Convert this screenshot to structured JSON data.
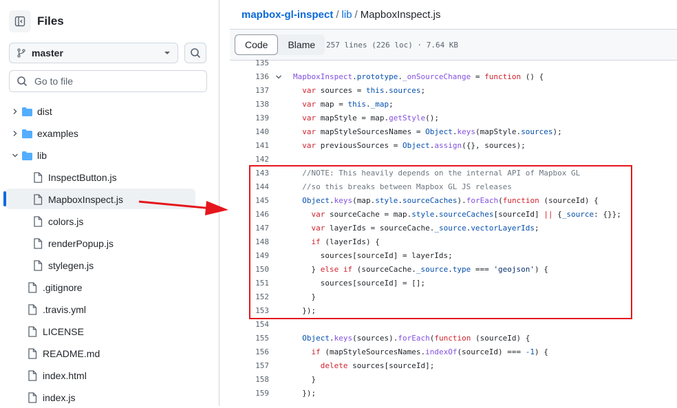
{
  "sidebar": {
    "title": "Files",
    "branch": "master",
    "goto_placeholder": "Go to file",
    "tree": [
      {
        "name": "dist",
        "type": "folder",
        "expanded": false
      },
      {
        "name": "examples",
        "type": "folder",
        "expanded": false
      },
      {
        "name": "lib",
        "type": "folder",
        "expanded": true
      },
      {
        "name": "InspectButton.js",
        "type": "file"
      },
      {
        "name": "MapboxInspect.js",
        "type": "file",
        "selected": true
      },
      {
        "name": "colors.js",
        "type": "file"
      },
      {
        "name": "renderPopup.js",
        "type": "file"
      },
      {
        "name": "stylegen.js",
        "type": "file"
      },
      {
        "name": ".gitignore",
        "type": "file"
      },
      {
        "name": ".travis.yml",
        "type": "file"
      },
      {
        "name": "LICENSE",
        "type": "file"
      },
      {
        "name": "README.md",
        "type": "file"
      },
      {
        "name": "index.html",
        "type": "file"
      },
      {
        "name": "index.js",
        "type": "file"
      }
    ]
  },
  "breadcrumb": {
    "repo": "mapbox-gl-inspect",
    "sep1": "/",
    "dir": "lib",
    "sep2": "/",
    "file": "MapboxInspect.js"
  },
  "toolbar": {
    "code_tab": "Code",
    "blame_tab": "Blame",
    "info": "257 lines (226 loc) · 7.64 KB"
  },
  "code_lines": [
    {
      "n": "135",
      "html": ""
    },
    {
      "n": "136",
      "html": "<span class='f'>MapboxInspect</span>.<span class='v'>prototype</span>.<span class='f'>_onSourceChange</span> = <span class='k'>function</span> () {"
    },
    {
      "n": "137",
      "html": "  <span class='k'>var</span> sources = <span class='v'>this</span>.<span class='v'>sources</span>;"
    },
    {
      "n": "138",
      "html": "  <span class='k'>var</span> map = <span class='v'>this</span>.<span class='v'>_map</span>;"
    },
    {
      "n": "139",
      "html": "  <span class='k'>var</span> mapStyle = map.<span class='f'>getStyle</span>();"
    },
    {
      "n": "140",
      "html": "  <span class='k'>var</span> mapStyleSourcesNames = <span class='v'>Object</span>.<span class='f'>keys</span>(mapStyle.<span class='v'>sources</span>);"
    },
    {
      "n": "141",
      "html": "  <span class='k'>var</span> previousSources = <span class='v'>Object</span>.<span class='f'>assign</span>({}, sources);"
    },
    {
      "n": "142",
      "html": ""
    },
    {
      "n": "143",
      "html": "  <span class='c'>//NOTE: This heavily depends on the internal API of Mapbox GL</span>"
    },
    {
      "n": "144",
      "html": "  <span class='c'>//so this breaks between Mapbox GL JS releases</span>"
    },
    {
      "n": "145",
      "html": "  <span class='v'>Object</span>.<span class='f'>keys</span>(map.<span class='v'>style</span>.<span class='v'>sourceCaches</span>).<span class='f'>forEach</span>(<span class='k'>function</span> (sourceId) {"
    },
    {
      "n": "146",
      "html": "    <span class='k'>var</span> sourceCache = map.<span class='v'>style</span>.<span class='v'>sourceCaches</span>[sourceId] <span class='k'>||</span> {<span class='v'>_source</span>: {}};"
    },
    {
      "n": "147",
      "html": "    <span class='k'>var</span> layerIds = sourceCache.<span class='v'>_source</span>.<span class='v'>vectorLayerIds</span>;"
    },
    {
      "n": "148",
      "html": "    <span class='k'>if</span> (layerIds) {"
    },
    {
      "n": "149",
      "html": "      sources[sourceId] = layerIds;"
    },
    {
      "n": "150",
      "html": "    } <span class='k'>else if</span> (sourceCache.<span class='v'>_source</span>.<span class='v'>type</span> === <span class='s'>'geojson'</span>) {"
    },
    {
      "n": "151",
      "html": "      sources[sourceId] = [];"
    },
    {
      "n": "152",
      "html": "    }"
    },
    {
      "n": "153",
      "html": "  });"
    },
    {
      "n": "154",
      "html": ""
    },
    {
      "n": "155",
      "html": "  <span class='v'>Object</span>.<span class='f'>keys</span>(sources).<span class='f'>forEach</span>(<span class='k'>function</span> (sourceId) {"
    },
    {
      "n": "156",
      "html": "    <span class='k'>if</span> (mapStyleSourcesNames.<span class='f'>indexOf</span>(sourceId) === <span class='v'>-1</span>) {"
    },
    {
      "n": "157",
      "html": "      <span class='k'>delete</span> sources[sourceId];"
    },
    {
      "n": "158",
      "html": "    }"
    },
    {
      "n": "159",
      "html": "  });"
    }
  ],
  "colors": {
    "accent": "#0969da",
    "annotation": "#e5161d"
  },
  "icons": {
    "panel": "sidebar-collapse-icon",
    "branch": "git-branch-icon",
    "search": "search-icon",
    "folder": "folder-icon",
    "file": "file-icon"
  }
}
